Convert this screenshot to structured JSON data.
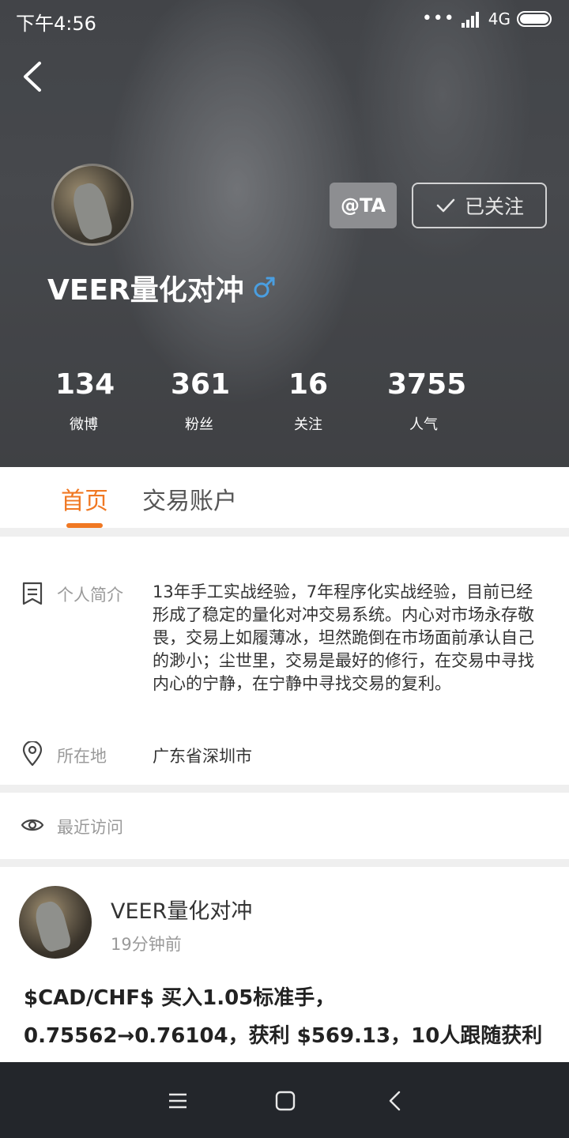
{
  "status_bar": {
    "time": "下午4:56",
    "signal_dots": "•••",
    "network": "4G"
  },
  "profile": {
    "name": "VEER量化对冲",
    "gender_symbol": "♂",
    "at_button": "@TA",
    "follow_button": "已关注",
    "stats": [
      {
        "value": "134",
        "label": "微博"
      },
      {
        "value": "361",
        "label": "粉丝"
      },
      {
        "value": "16",
        "label": "关注"
      },
      {
        "value": "3755",
        "label": "人气"
      }
    ]
  },
  "tabs": [
    {
      "label": "首页",
      "active": true
    },
    {
      "label": "交易账户",
      "active": false
    }
  ],
  "info": {
    "bio_label": "个人简介",
    "bio_text": "13年手工实战经验，7年程序化实战经验，目前已经形成了稳定的量化对冲交易系统。内心对市场永存敬畏，交易上如履薄冰，坦然跪倒在市场面前承认自己的渺小；尘世里，交易是最好的修行，在交易中寻找内心的宁静，在宁静中寻找交易的复利。",
    "location_label": "所在地",
    "location_value": "广东省深圳市"
  },
  "visitors": {
    "label": "最近访问"
  },
  "post": {
    "author": "VEER量化对冲",
    "time": "19分钟前",
    "line1": "$CAD/CHF$ 买入1.05标准手，",
    "line2": "0.75562→0.76104，获利 $569.13，10人跟随获利"
  },
  "colors": {
    "accent": "#f07823",
    "gender_blue": "#4a9ee0"
  }
}
